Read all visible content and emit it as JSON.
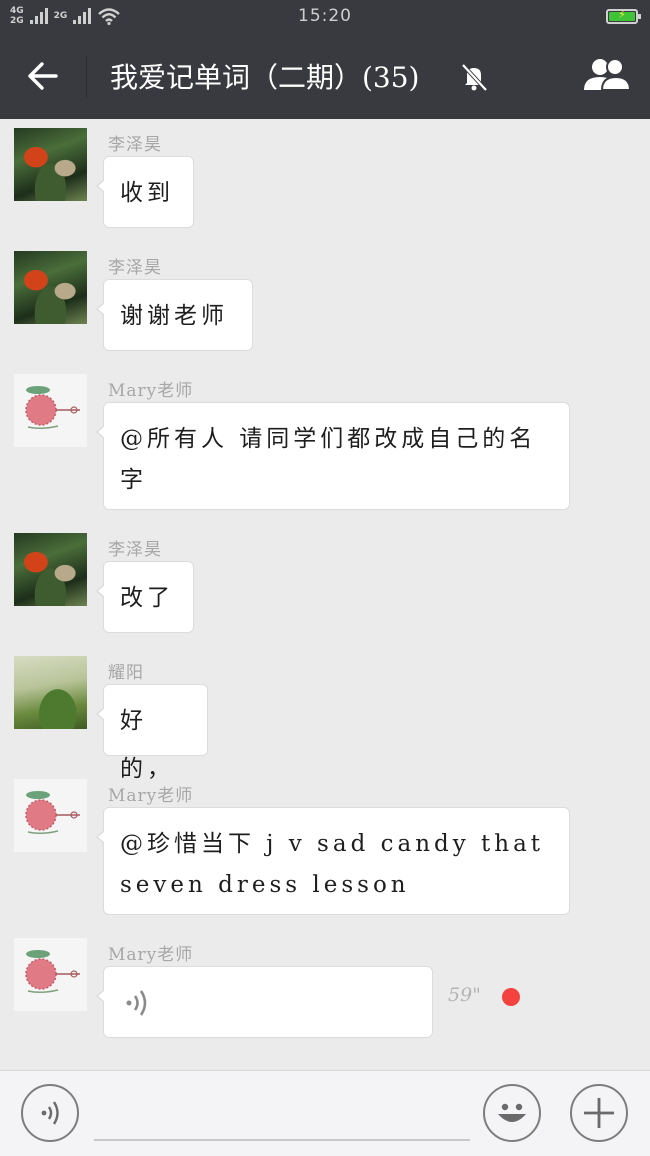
{
  "status_bar": {
    "network_top": "4G",
    "network_bottom": "2G",
    "network_2": "2G",
    "time": "15:20"
  },
  "nav": {
    "title": "我爱记单词（二期）(35)"
  },
  "messages": [
    {
      "sender": "李泽昊",
      "text": "收到",
      "avatar": "duck-avatar"
    },
    {
      "sender": "李泽昊",
      "text": "谢谢老师",
      "avatar": "duck-avatar"
    },
    {
      "sender": "Mary老师",
      "text": "@所有人 请同学们都改成自己的名字",
      "avatar": "ornament-avatar"
    },
    {
      "sender": "李泽昊",
      "text": "改了",
      "avatar": "duck-avatar"
    },
    {
      "sender": "耀阳",
      "text": "好的，",
      "avatar": "field-avatar"
    },
    {
      "sender": "Mary老师",
      "text": "@珍惜当下 j v sad candy that seven dress lesson",
      "avatar": "ornament-avatar"
    },
    {
      "sender": "Mary老师",
      "voice_duration": "59\"",
      "avatar": "ornament-avatar"
    }
  ],
  "input": {
    "placeholder": ""
  },
  "colors": {
    "bar": "#393a3f",
    "background": "#ebebeb",
    "unread": "#f4433f",
    "battery": "#3ec436"
  }
}
